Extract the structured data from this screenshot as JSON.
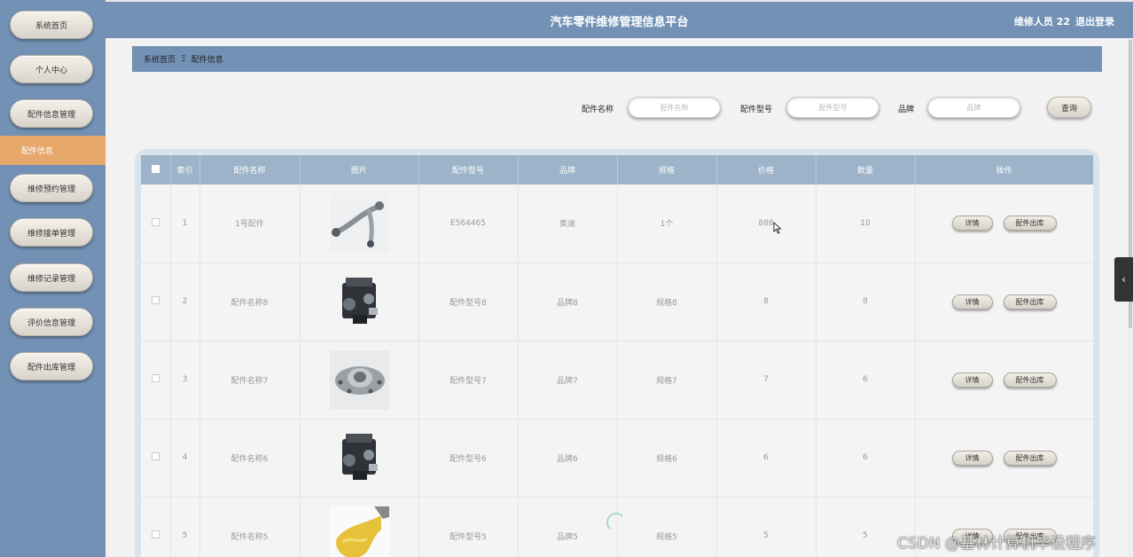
{
  "app": {
    "title": "汽车零件维修管理信息平台",
    "user": "维修人员 22",
    "logout": "退出登录"
  },
  "sidebar": {
    "items": [
      {
        "label": "系统首页"
      },
      {
        "label": "个人中心"
      },
      {
        "label": "配件信息管理"
      },
      {
        "label": "维修预约管理"
      },
      {
        "label": "维修接单管理"
      },
      {
        "label": "维修记录管理"
      },
      {
        "label": "评价信息管理"
      },
      {
        "label": "配件出库管理"
      }
    ],
    "active_sub": "配件信息"
  },
  "breadcrumb": {
    "home": "系统首页",
    "separator": "Ξ",
    "current": "配件信息"
  },
  "search": {
    "name_label": "配件名称",
    "name_placeholder": "配件名称",
    "model_label": "配件型号",
    "model_placeholder": "配件型号",
    "brand_label": "品牌",
    "brand_placeholder": "品牌",
    "query_button": "查询"
  },
  "table": {
    "headers": {
      "index": "索引",
      "name": "配件名称",
      "image": "图片",
      "model": "配件型号",
      "brand": "品牌",
      "spec": "规格",
      "price": "价格",
      "qty": "数量",
      "ops": "操作"
    },
    "detail_label": "详情",
    "out_label": "配件出库",
    "rows": [
      {
        "index": "1",
        "name": "1号配件",
        "image": "control-arm",
        "model": "E564465",
        "brand": "奥迪",
        "spec": "1个",
        "price": "888",
        "qty": "10"
      },
      {
        "index": "2",
        "name": "配件名称8",
        "image": "engine",
        "model": "配件型号8",
        "brand": "品牌8",
        "spec": "规格8",
        "price": "8",
        "qty": "8"
      },
      {
        "index": "3",
        "name": "配件名称7",
        "image": "wheel-hub",
        "model": "配件型号7",
        "brand": "品牌7",
        "spec": "规格7",
        "price": "7",
        "qty": "6"
      },
      {
        "index": "4",
        "name": "配件名称6",
        "image": "engine",
        "model": "配件型号6",
        "brand": "品牌6",
        "spec": "规格6",
        "price": "6",
        "qty": "6"
      },
      {
        "index": "5",
        "name": "配件名称5",
        "image": "oil",
        "model": "配件型号5",
        "brand": "品牌5",
        "spec": "规格5",
        "price": "5",
        "qty": "5"
      }
    ]
  },
  "watermark": "CSDN @基林计算机毕设程序",
  "colors": {
    "primary": "#7291b4",
    "active": "#e6a86a",
    "table_header": "#9cb3c9"
  }
}
